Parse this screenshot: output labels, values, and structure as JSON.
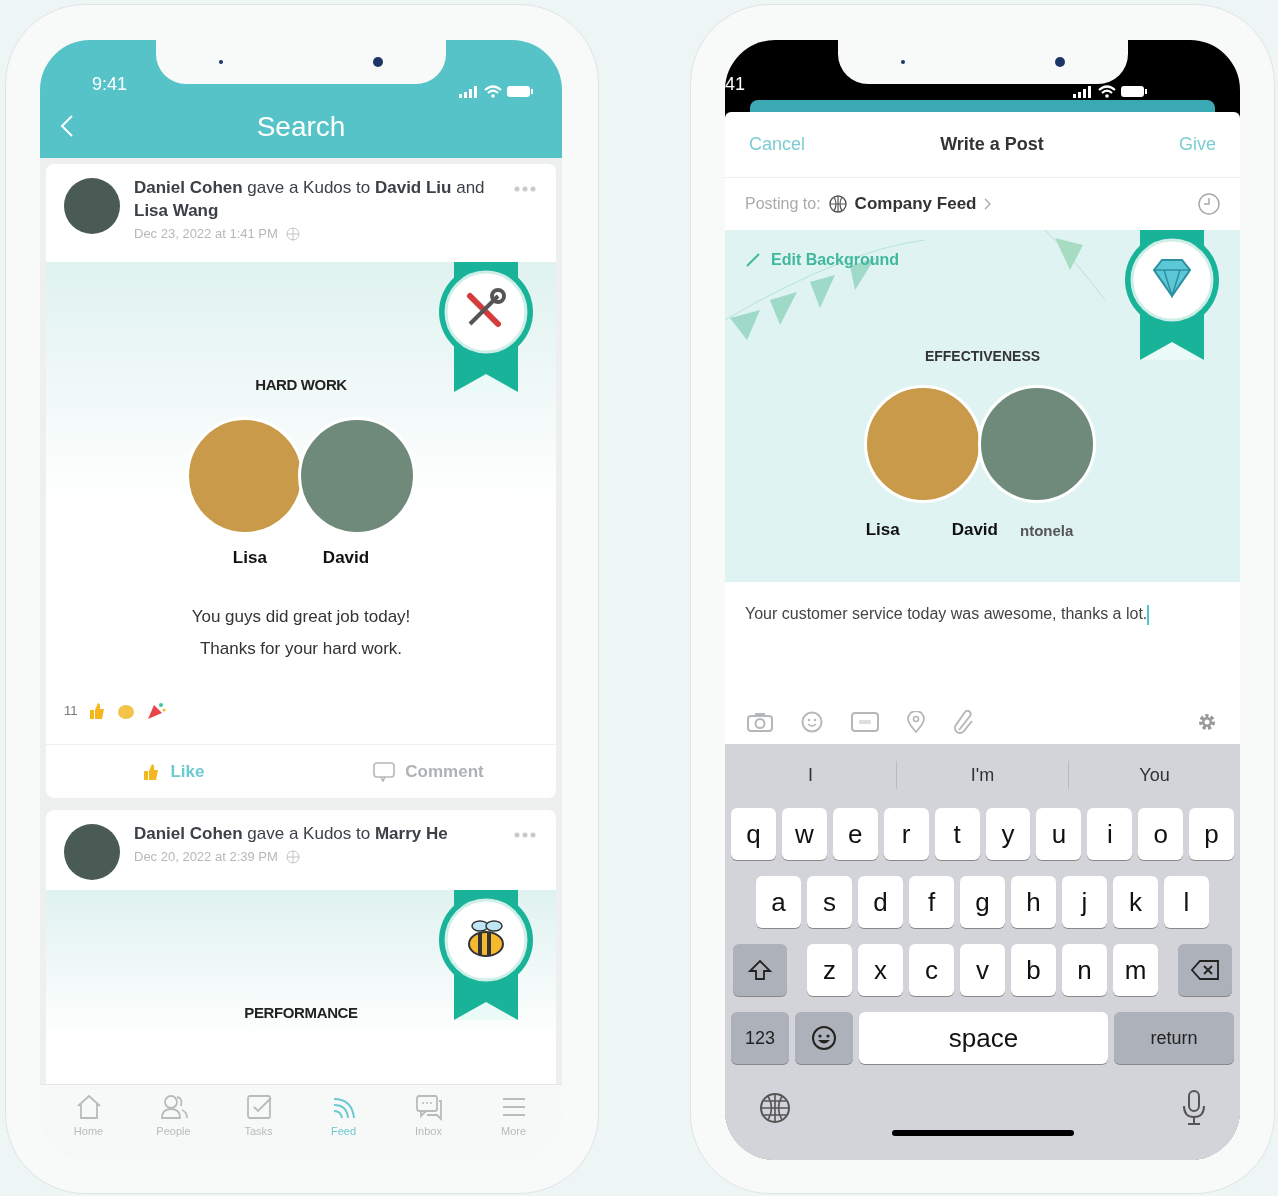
{
  "left_phone": {
    "status_bar": {
      "time": "9:41"
    },
    "nav": {
      "title": "Search"
    },
    "posts": [
      {
        "headline": "**Daniel Cohen** gave a Kudos to **David Liu** and **Lisa Wang**",
        "timestamp": "Dec 23, 2022 at 1:41 PM",
        "kind": "tools",
        "award": "HARD WORK",
        "recipients": [
          "Lisa",
          "David"
        ],
        "message_lines": [
          "You guys did great job today!",
          "Thanks for your hard work."
        ],
        "reaction_count": "11",
        "actions": [
          {
            "label": "Like",
            "kind": "like",
            "selected": true
          },
          {
            "label": "Comment",
            "kind": "comment",
            "selected": false
          }
        ]
      },
      {
        "headline": "**Daniel Cohen** gave a Kudos to **Marry He**",
        "timestamp": "Dec 20, 2022 at 2:39 PM",
        "kind": "bee",
        "award": "PERFORMANCE"
      }
    ],
    "tab_bar": [
      {
        "label": "Home",
        "kind": "home",
        "selected": false
      },
      {
        "label": "People",
        "kind": "people",
        "selected": false
      },
      {
        "label": "Tasks",
        "kind": "tasks",
        "selected": false
      },
      {
        "label": "Feed",
        "kind": "feed",
        "selected": true
      },
      {
        "label": "Inbox",
        "kind": "inbox",
        "selected": false
      },
      {
        "label": "More",
        "kind": "more",
        "selected": false
      }
    ]
  },
  "right_phone": {
    "status_bar": {
      "time": "41"
    },
    "header": {
      "cancel": "Cancel",
      "title": "Write a Post",
      "give": "Give"
    },
    "posting": {
      "label": "Posting to:",
      "target": "Company Feed"
    },
    "edit_background": "Edit Background",
    "badge": {
      "kind": "diamond"
    },
    "award": "EFFECTIVENESS",
    "recipients": [
      "Lisa",
      "David",
      "ntonela"
    ],
    "message": "Your customer service today was awesome, thanks a lot.",
    "keyboard": {
      "suggestions": [
        "I",
        "I'm",
        "You"
      ],
      "rows": [
        [
          "q",
          "w",
          "e",
          "r",
          "t",
          "y",
          "u",
          "i",
          "o",
          "p"
        ],
        [
          "a",
          "s",
          "d",
          "f",
          "g",
          "h",
          "j",
          "k",
          "l"
        ],
        [
          "z",
          "x",
          "c",
          "v",
          "b",
          "n",
          "m"
        ]
      ],
      "numbers_key": "123",
      "space_key": "space",
      "return_key": "return"
    }
  }
}
